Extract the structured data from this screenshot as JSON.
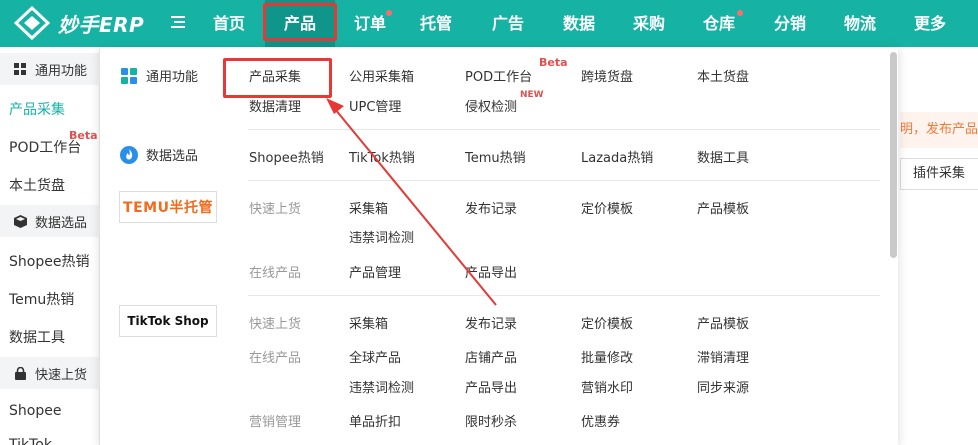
{
  "app": {
    "title": "妙手ERP"
  },
  "nav": {
    "items": [
      "首页",
      "产品",
      "订单",
      "托管",
      "广告",
      "数据",
      "采购",
      "仓库",
      "分销",
      "物流",
      "更多"
    ]
  },
  "sidebar": {
    "groups": [
      "通用功能",
      "数据选品",
      "快速上货"
    ],
    "items": [
      "产品采集",
      "POD工作台",
      "本土货盘",
      "Shopee热销",
      "Temu热销",
      "数据工具",
      "Shopee",
      "TikTok"
    ],
    "beta": "Beta"
  },
  "right": {
    "notice": "明，发布产品",
    "plugin_button": "插件采集"
  },
  "dropdown": {
    "general": {
      "label": "通用功能",
      "links": [
        "产品采集",
        "公用采集箱",
        "POD工作台",
        "跨境货盘",
        "本土货盘",
        "数据清理",
        "UPC管理",
        "侵权检测"
      ],
      "beta": "Beta",
      "new": "NEW"
    },
    "data": {
      "label": "数据选品",
      "links": [
        "Shopee热销",
        "TikTok热销",
        "Temu热销",
        "Lazada热销",
        "数据工具"
      ]
    },
    "temu": {
      "logo": "TEMU半托管",
      "quick_label": "快速上货",
      "quick_links": [
        "采集箱",
        "发布记录",
        "定价模板",
        "产品模板",
        "违禁词检测"
      ],
      "online_label": "在线产品",
      "online_links": [
        "产品管理",
        "产品导出"
      ]
    },
    "tiktok": {
      "logo": "TikTok Shop",
      "quick_label": "快速上货",
      "quick_links": [
        "采集箱",
        "发布记录",
        "定价模板",
        "产品模板"
      ],
      "online_label": "在线产品",
      "online_links": [
        "全球产品",
        "店铺产品",
        "批量修改",
        "滞销清理",
        "违禁词检测",
        "产品导出",
        "营销水印",
        "同步来源"
      ],
      "marketing_label": "营销管理",
      "marketing_links": [
        "单品折扣",
        "限时秒杀",
        "优惠券"
      ]
    }
  },
  "colors": {
    "brand": "#16b3a5",
    "highlight": "#e53935",
    "badge": "#e05050"
  }
}
